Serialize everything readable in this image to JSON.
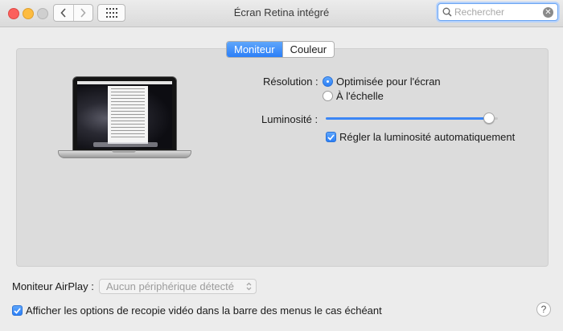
{
  "window": {
    "title": "Écran Retina intégré",
    "buttons": [
      "close",
      "minimize",
      "zoom"
    ]
  },
  "toolbar": {
    "back_icon": "chevron-left-icon",
    "forward_icon": "chevron-right-icon",
    "show_all_icon": "grid-icon",
    "search": {
      "value": "",
      "placeholder": "Rechercher",
      "clear_icon": "clear-icon"
    }
  },
  "tabs": [
    {
      "label": "Moniteur",
      "selected": true
    },
    {
      "label": "Couleur",
      "selected": false
    }
  ],
  "display": {
    "resolution_label": "Résolution :",
    "resolution_options": [
      {
        "label": "Optimisée pour l'écran",
        "selected": true
      },
      {
        "label": "À l'échelle",
        "selected": false
      }
    ],
    "brightness_label": "Luminosité :",
    "brightness_level": 0.98,
    "auto_brightness": {
      "label": "Régler la luminosité automatiquement",
      "checked": true
    }
  },
  "airplay": {
    "label": "Moniteur AirPlay :",
    "selected_value": "Aucun périphérique détecté",
    "enabled": false
  },
  "mirroring_option": {
    "label": "Afficher les options de recopie vidéo dans la barre des menus le cas échéant",
    "checked": true
  },
  "help": {
    "label": "?"
  },
  "colors": {
    "accent": "#2b7ff7",
    "close": "#fc605c",
    "minimize": "#fdbc40"
  }
}
